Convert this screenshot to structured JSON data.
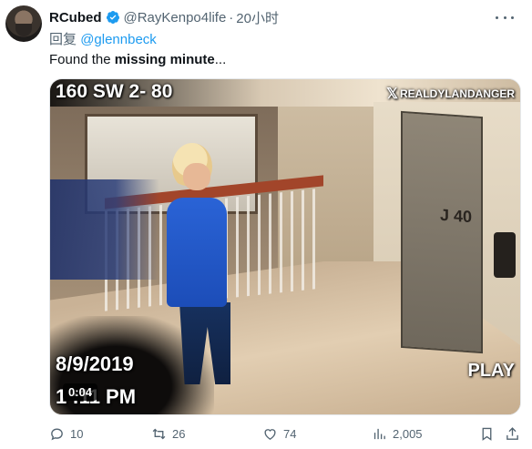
{
  "post": {
    "author_name": "RCubed",
    "author_handle": "@RayKenpo4life",
    "separator": "·",
    "time": "20小时",
    "reply_prefix": "回复",
    "reply_to": "@glennbeck",
    "text_start": "Found the ",
    "text_bold": "missing minute",
    "text_end": "..."
  },
  "media": {
    "camera_id": "160 SW 2- 80",
    "watermark": "REALDYLANDANGER",
    "date": "8/9/2019",
    "clock": "1   :11 PM",
    "status": "PLAY",
    "duration": "0:04"
  },
  "stats": {
    "replies": "10",
    "reposts": "26",
    "likes": "74",
    "views": "2,005"
  },
  "colors": {
    "verified": "#1d9bf0",
    "link": "#1d9bf0",
    "muted": "#536471",
    "text": "#0f1419",
    "jacket": "#2a63d6"
  },
  "icons": [
    "verified-badge-icon",
    "more-icon",
    "reply-icon",
    "repost-icon",
    "like-icon",
    "views-icon",
    "bookmark-icon",
    "share-icon",
    "x-logo-icon"
  ]
}
